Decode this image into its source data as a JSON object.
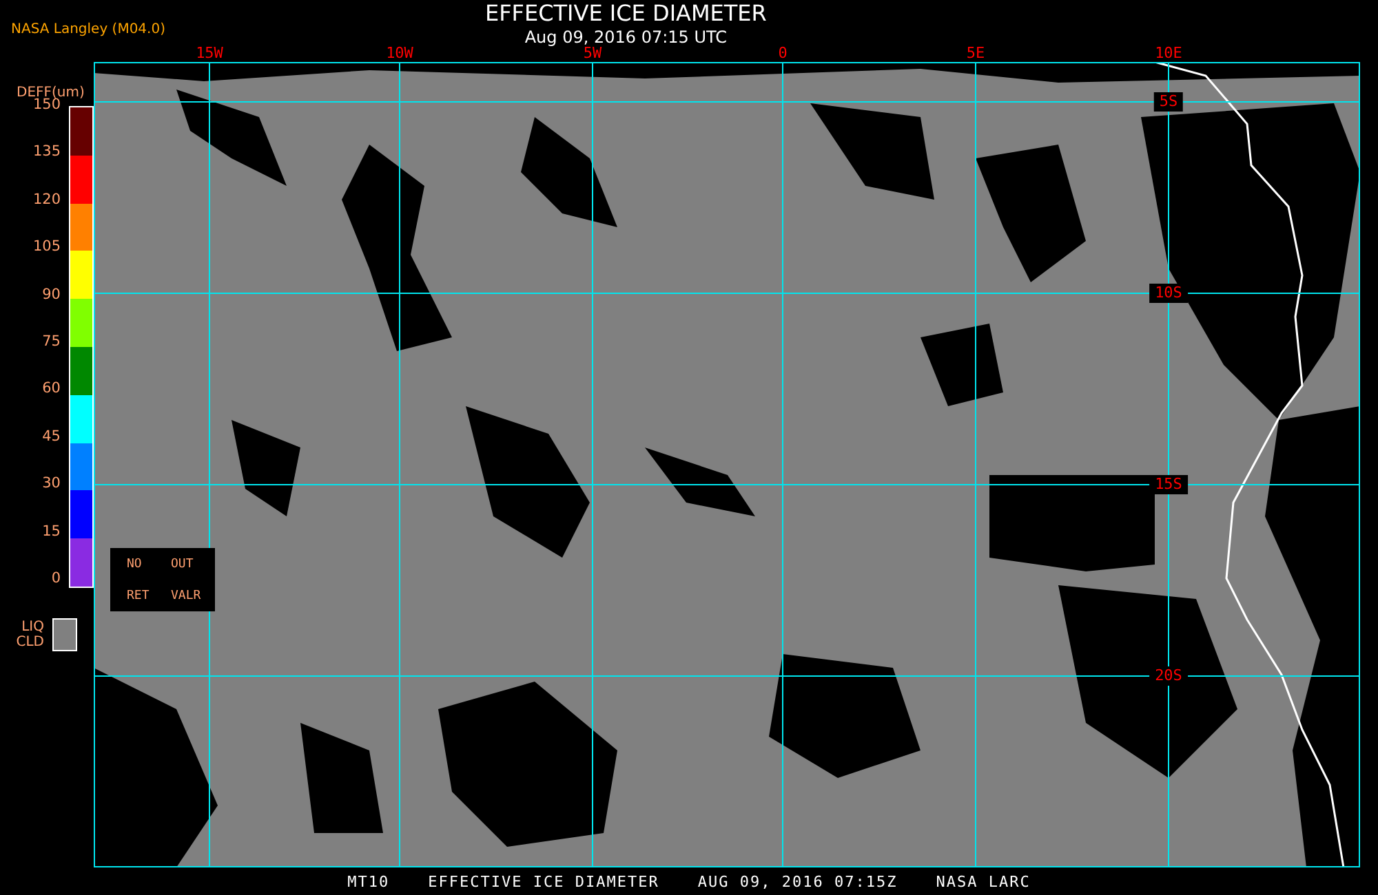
{
  "source_label": "NASA Langley (M04.0)",
  "title": "EFFECTIVE ICE DIAMETER",
  "subtitle": "Aug 09, 2016 07:15 UTC",
  "legend": {
    "unit": "DEFF(um)",
    "ticks": [
      "150",
      "135",
      "120",
      "105",
      "90",
      "75",
      "60",
      "45",
      "30",
      "15",
      "0"
    ],
    "segments": [
      {
        "color": "#660000"
      },
      {
        "color": "#ff0000"
      },
      {
        "color": "#ff8000"
      },
      {
        "color": "#ffff00"
      },
      {
        "color": "#80ff00"
      },
      {
        "color": "#008800"
      },
      {
        "color": "#00ffff"
      },
      {
        "color": "#0080ff"
      },
      {
        "color": "#0000ff"
      },
      {
        "color": "#8a2be2"
      }
    ],
    "no_retrieval": [
      "NO",
      "OUT",
      "RET",
      "VALR"
    ],
    "liquid_cloud": [
      "LIQ",
      "CLD"
    ]
  },
  "map": {
    "longitude_labels": [
      "15W",
      "10W",
      "5W",
      "0",
      "5E",
      "10E"
    ],
    "latitude_labels": [
      "5S",
      "10S",
      "15S",
      "20S"
    ]
  },
  "footer": [
    "MT10",
    "EFFECTIVE ICE DIAMETER",
    "AUG 09, 2016 07:15Z",
    "NASA LARC"
  ]
}
